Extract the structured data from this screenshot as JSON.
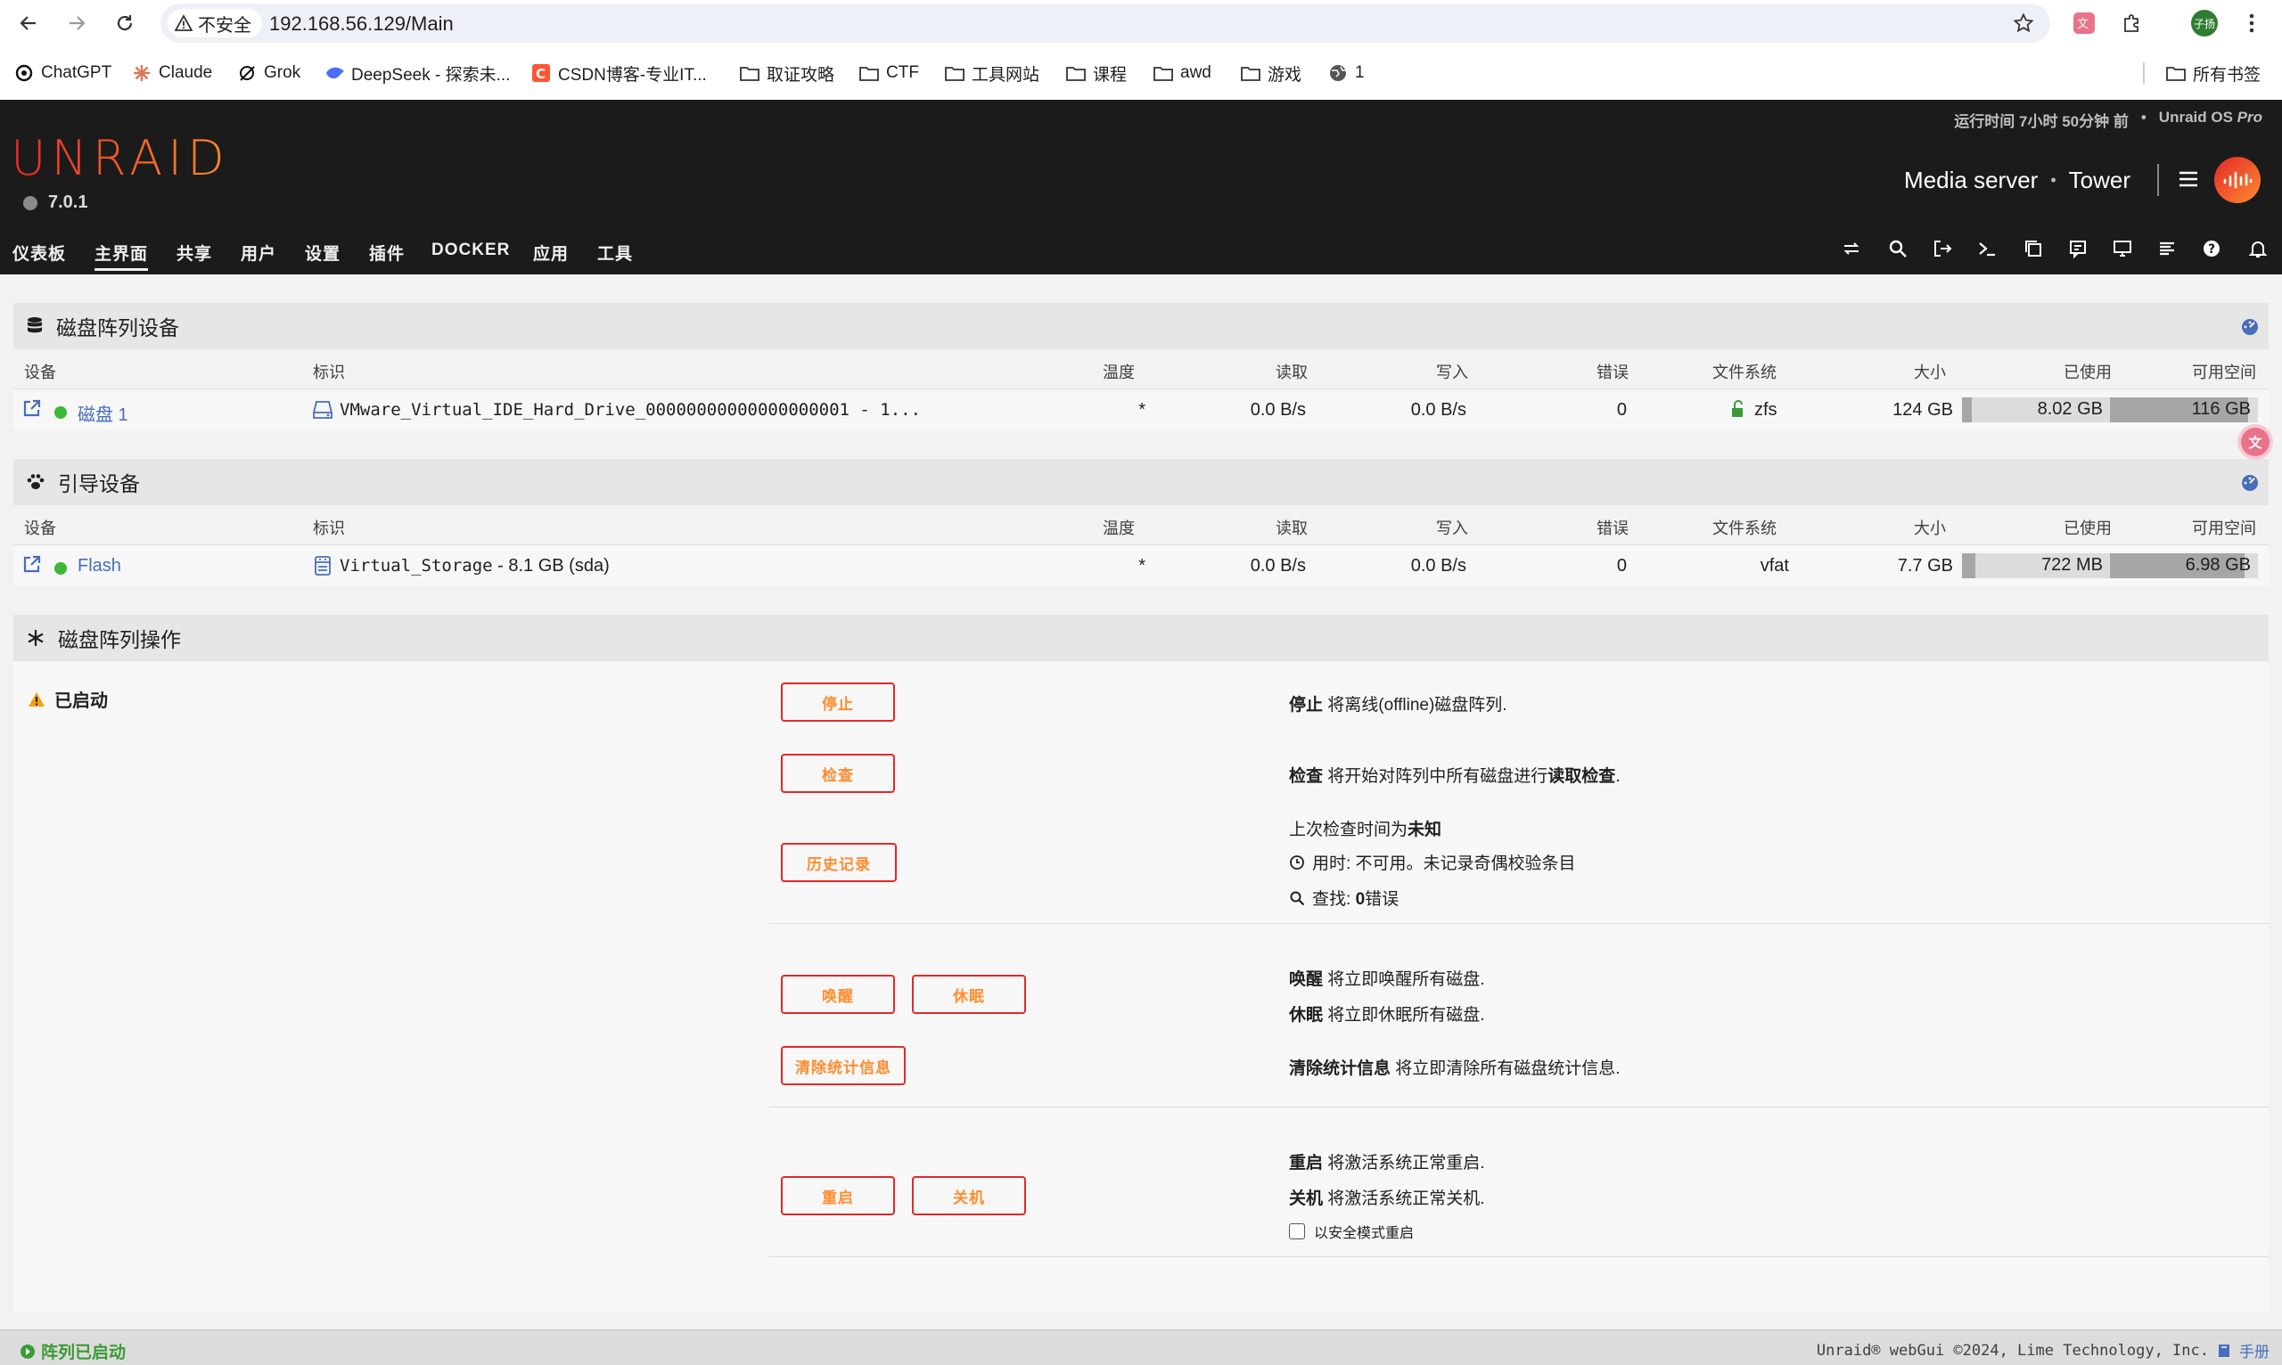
{
  "browser": {
    "security_label": "不安全",
    "url": "192.168.56.129/Main",
    "profile_initials": "子扬",
    "bookmarks": [
      {
        "label": "ChatGPT",
        "icon": "chatgpt-icon"
      },
      {
        "label": "Claude",
        "icon": "claude-icon"
      },
      {
        "label": "Grok",
        "icon": "grok-icon"
      },
      {
        "label": "DeepSeek - 探索未...",
        "icon": "deepseek-icon"
      },
      {
        "label": "CSDN博客-专业IT...",
        "icon": "csdn-icon"
      },
      {
        "label": "取证攻略",
        "icon": "folder-icon"
      },
      {
        "label": "CTF",
        "icon": "folder-icon"
      },
      {
        "label": "工具网站",
        "icon": "folder-icon"
      },
      {
        "label": "课程",
        "icon": "folder-icon"
      },
      {
        "label": "awd",
        "icon": "folder-icon"
      },
      {
        "label": "游戏",
        "icon": "folder-icon"
      },
      {
        "label": "1",
        "icon": "globe-icon"
      }
    ],
    "all_bookmarks": "所有书签"
  },
  "header": {
    "logo": "UNRAID",
    "version": "7.0.1",
    "uptime": "运行时间 7小时 50分钟 前",
    "edition_prefix": "Unraid OS",
    "edition": "Pro",
    "server_description": "Media server",
    "server_name": "Tower",
    "nav": [
      "仪表板",
      "主界面",
      "共享",
      "用户",
      "设置",
      "插件",
      "DOCKER",
      "应用",
      "工具"
    ],
    "active_nav": "主界面",
    "accent_colors": {
      "start": "#e22828",
      "end": "#ff8c2f"
    }
  },
  "columns": {
    "device": "设备",
    "identification": "标识",
    "temp": "温度",
    "reads": "读取",
    "writes": "写入",
    "errors": "错误",
    "fs": "文件系统",
    "size": "大小",
    "used": "已使用",
    "free": "可用空间"
  },
  "array_devices": {
    "title": "磁盘阵列设备",
    "rows": [
      {
        "device": "磁盘 1",
        "identification": "VMware_Virtual_IDE_Hard_Drive_00000000000000000001 - 1...",
        "temp": "*",
        "reads": "0.0 B/s",
        "writes": "0.0 B/s",
        "errors": "0",
        "fs": "zfs",
        "size": "124 GB",
        "used": "8.02 GB",
        "free": "116 GB",
        "used_fraction": 0.065,
        "free_fraction": 0.935
      }
    ]
  },
  "boot_device": {
    "title": "引导设备",
    "rows": [
      {
        "device": "Flash",
        "identification_name": "Virtual_Storage",
        "identification_rest": " - 8.1 GB (sda)",
        "temp": "*",
        "reads": "0.0 B/s",
        "writes": "0.0 B/s",
        "errors": "0",
        "fs": "vfat",
        "size": "7.7 GB",
        "used": "722 MB",
        "free": "6.98 GB",
        "used_fraction": 0.09,
        "free_fraction": 0.91
      }
    ]
  },
  "array_ops": {
    "title": "磁盘阵列操作",
    "status": "已启动",
    "buttons": {
      "stop": "停止",
      "check": "检查",
      "history": "历史记录",
      "spin_up": "唤醒",
      "spin_down": "休眠",
      "clear_stats": "清除统计信息",
      "reboot": "重启",
      "shutdown": "关机"
    },
    "descriptions": {
      "stop_bold": "停止",
      "stop_text": " 将离线(offline)磁盘阵列.",
      "check_bold": "检查",
      "check_text": " 将开始对阵列中所有磁盘进行",
      "check_bold2": "读取检查",
      "check_end": ".",
      "last_check_prefix": "上次检查时间为",
      "last_check_value": "未知",
      "duration": "用时: 不可用。未记录奇偶校验条目",
      "found_prefix": "查找: ",
      "found_value": "0",
      "found_suffix": "错误",
      "spinup_bold": "唤醒",
      "spinup_text": " 将立即唤醒所有磁盘.",
      "spindown_bold": "休眠",
      "spindown_text": " 将立即休眠所有磁盘.",
      "clear_bold": "清除统计信息",
      "clear_text": " 将立即清除所有磁盘统计信息.",
      "reboot_bold": "重启",
      "reboot_text": " 将激活系统正常重启.",
      "shutdown_bold": "关机",
      "shutdown_text": " 将激活系统正常关机.",
      "safe_mode": "以安全模式重启"
    }
  },
  "footer": {
    "status": "阵列已启动",
    "copyright": "Unraid® webGui ©2024, Lime Technology, Inc.",
    "manual": "手册"
  }
}
